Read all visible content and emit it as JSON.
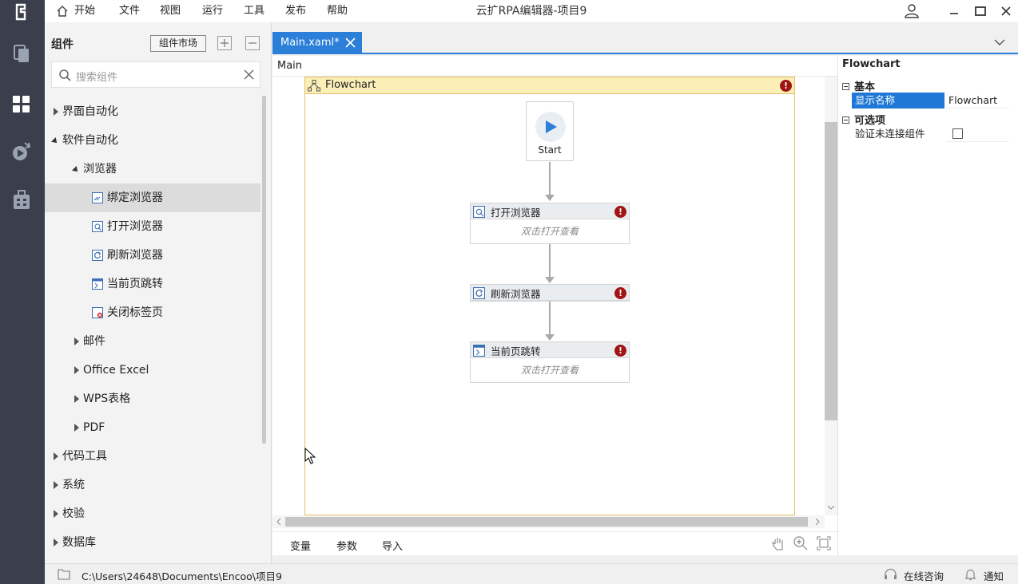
{
  "app": {
    "window_title": "云扩RPA编辑器-项目9"
  },
  "menu": {
    "home": "开始",
    "file": "文件",
    "view": "视图",
    "run": "运行",
    "tools": "工具",
    "publish": "发布",
    "help": "帮助"
  },
  "component_panel": {
    "title": "组件",
    "market_button": "组件市场",
    "search_placeholder": "搜索组件",
    "tree": [
      {
        "label": "界面自动化",
        "state": "collapsed",
        "level": 0
      },
      {
        "label": "软件自动化",
        "state": "expanded",
        "level": 0
      },
      {
        "label": "浏览器",
        "state": "expanded",
        "level": 1
      },
      {
        "label": "绑定浏览器",
        "state": "leaf",
        "level": 2,
        "selected": true
      },
      {
        "label": "打开浏览器",
        "state": "leaf",
        "level": 2
      },
      {
        "label": "刷新浏览器",
        "state": "leaf",
        "level": 2
      },
      {
        "label": "当前页跳转",
        "state": "leaf",
        "level": 2
      },
      {
        "label": "关闭标签页",
        "state": "leaf",
        "level": 2
      },
      {
        "label": "邮件",
        "state": "collapsed",
        "level": 1
      },
      {
        "label": "Office Excel",
        "state": "collapsed",
        "level": 1
      },
      {
        "label": "WPS表格",
        "state": "collapsed",
        "level": 1
      },
      {
        "label": "PDF",
        "state": "collapsed",
        "level": 1
      },
      {
        "label": "代码工具",
        "state": "collapsed",
        "level": 0
      },
      {
        "label": "系统",
        "state": "collapsed",
        "level": 0
      },
      {
        "label": "校验",
        "state": "collapsed",
        "level": 0
      },
      {
        "label": "数据库",
        "state": "collapsed",
        "level": 0
      }
    ]
  },
  "editor": {
    "tab_label": "Main.xaml*",
    "breadcrumb": "Main",
    "flowchart_title": "Flowchart",
    "start_label": "Start",
    "nodes": [
      {
        "title": "打开浏览器",
        "hint": "双击打开查看",
        "has_body": true
      },
      {
        "title": "刷新浏览器",
        "hint": "",
        "has_body": false
      },
      {
        "title": "当前页跳转",
        "hint": "双击打开查看",
        "has_body": true
      }
    ],
    "error_mark": "!",
    "bottom_tabs": {
      "variables": "变量",
      "arguments": "参数",
      "imports": "导入"
    }
  },
  "properties": {
    "title": "Flowchart",
    "section_basic": "基本",
    "display_name_key": "显示名称",
    "display_name_value": "Flowchart",
    "section_optional": "可选项",
    "validate_key": "验证未连接组件",
    "validate_checked": false
  },
  "status_bar": {
    "path": "C:\\Users\\24648\\Documents\\Encoo\\项目9",
    "online_help": "在线咨询",
    "notifications": "通知"
  },
  "colors": {
    "accent": "#2b7fd8",
    "rail_bg": "#3a3f4b",
    "error": "#a01414",
    "flow_header": "#fbeeb7"
  }
}
